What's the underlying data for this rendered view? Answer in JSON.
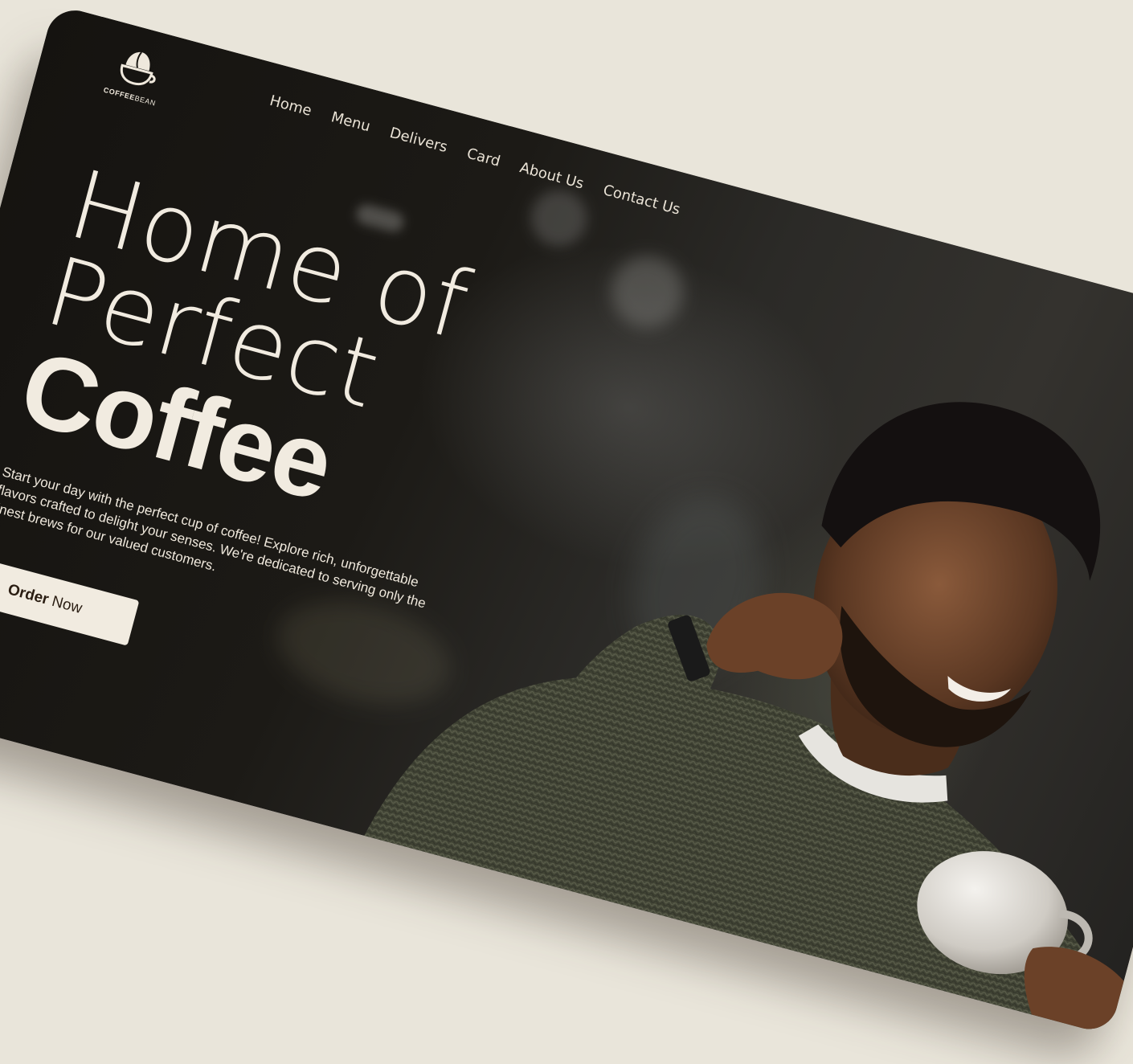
{
  "brand": {
    "name_bold": "COFFEE",
    "name_light": "BEAN",
    "logo_icon": "coffee-cup-bean-icon"
  },
  "nav": {
    "items": [
      {
        "label": "Home"
      },
      {
        "label": "Menu"
      },
      {
        "label": "Delivers"
      },
      {
        "label": "Card"
      },
      {
        "label": "About Us"
      },
      {
        "label": "Contact Us"
      }
    ]
  },
  "hero": {
    "line1": "Home of",
    "line2": "Perfect",
    "line3": "Coffee",
    "description": "Start your day with the perfect cup of coffee! Explore rich, unforgettable flavors crafted to delight your senses. We're dedicated to serving only the finest brews for our valued customers.",
    "cta_bold": "Order",
    "cta_rest": "Now"
  },
  "colors": {
    "background": "#e9e5da",
    "hero_text": "#f1ebe0",
    "button_bg": "#f1ebe0",
    "button_text": "#2a1d12"
  }
}
